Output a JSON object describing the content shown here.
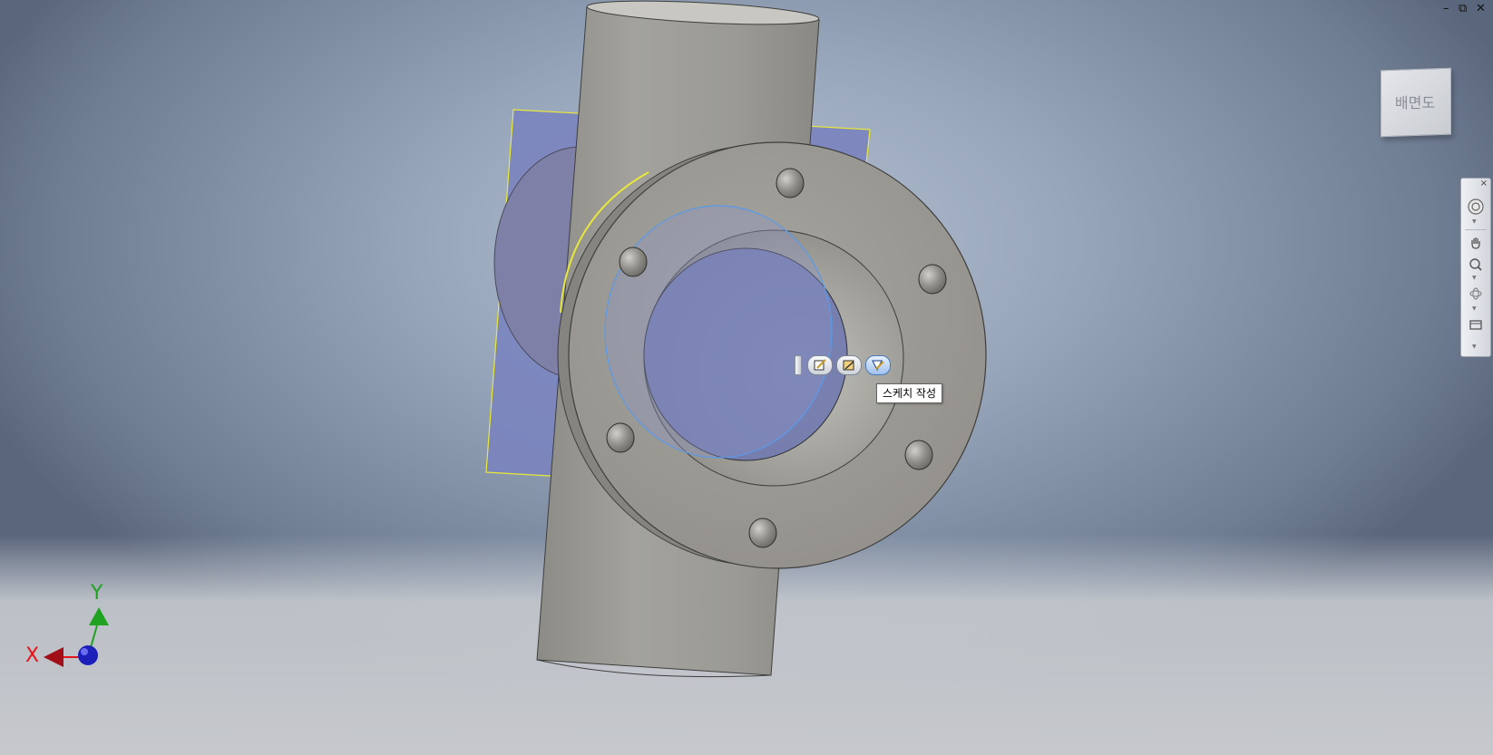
{
  "window_controls": {
    "minimize": "–",
    "restore": "⧉",
    "close": "✕"
  },
  "viewcube": {
    "face_label": "배면도"
  },
  "navigation_bar": {
    "close": "×",
    "tools": [
      "steering-wheel-icon",
      "pan-icon",
      "zoom-icon",
      "orbit-icon",
      "look-at-icon"
    ]
  },
  "mini_toolbar": {
    "buttons": [
      "edit-sketch-icon",
      "edit-feature-icon",
      "create-sketch-icon"
    ],
    "active_index": 2
  },
  "tooltip": {
    "text": "스케치 작성"
  },
  "axis_triad": {
    "x_label": "X",
    "y_label": "Y",
    "x_color": "#e4141b",
    "y_color": "#1fa21f",
    "z_color": "#1c20b8"
  },
  "colors": {
    "sketch_plane": "#7a84bf",
    "model_gray": "#9d9c96",
    "highlight": "#e8e83a",
    "selection_blue": "#5a9ae8"
  }
}
